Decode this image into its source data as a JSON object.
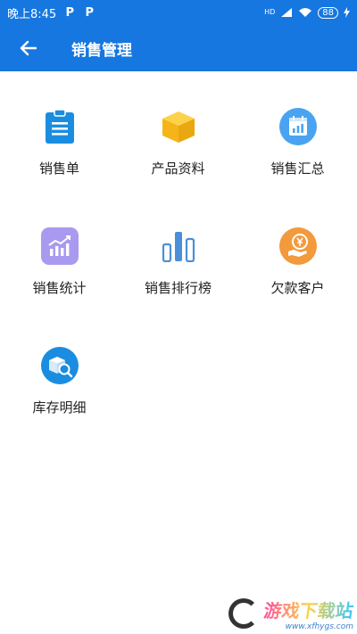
{
  "status_bar": {
    "time": "晚上8:45",
    "hd_label": "HD",
    "battery": "88"
  },
  "app_bar": {
    "title": "销售管理",
    "back_icon": "arrow-left-icon"
  },
  "tiles": [
    {
      "label": "销售单",
      "icon": "clipboard-list-icon",
      "color": "#1a8de0"
    },
    {
      "label": "产品资料",
      "icon": "box-icon",
      "color": "#f5b519"
    },
    {
      "label": "销售汇总",
      "icon": "calendar-chart-icon",
      "color": "#4aa3f0"
    },
    {
      "label": "销售统计",
      "icon": "trend-chart-icon",
      "color": "#9b8be8"
    },
    {
      "label": "销售排行榜",
      "icon": "bar-chart-icon",
      "color": "#4b8fd8"
    },
    {
      "label": "欠款客户",
      "icon": "yen-hand-icon",
      "color": "#f29a3c"
    },
    {
      "label": "库存明细",
      "icon": "inventory-search-icon",
      "color": "#1a8de0"
    }
  ],
  "watermark": {
    "text": "游戏下载站",
    "url_text": "www.xfhygs.com"
  }
}
